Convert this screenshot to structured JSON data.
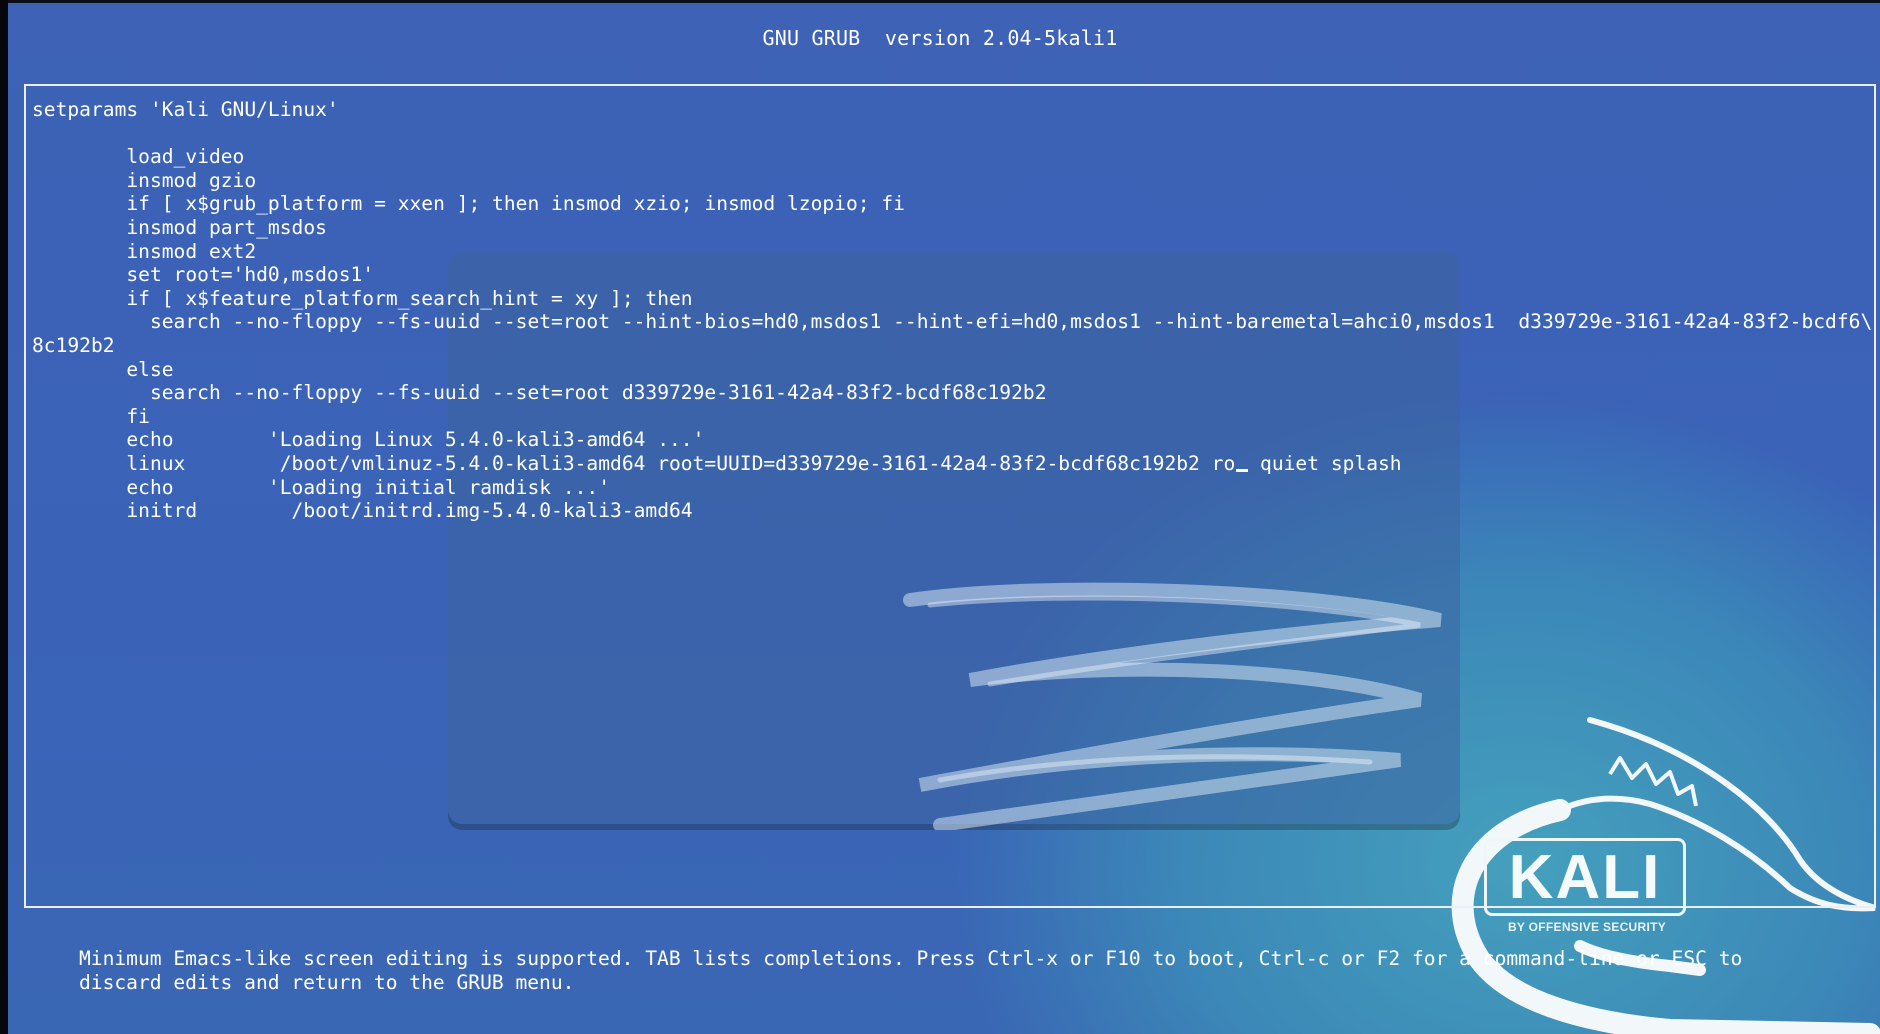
{
  "header": {
    "title": "GNU GRUB  version 2.04-5kali1"
  },
  "editor": {
    "lines": [
      "setparams 'Kali GNU/Linux'",
      "",
      "        load_video",
      "        insmod gzio",
      "        if [ x$grub_platform = xxen ]; then insmod xzio; insmod lzopio; fi",
      "        insmod part_msdos",
      "        insmod ext2",
      "        set root='hd0,msdos1'",
      "        if [ x$feature_platform_search_hint = xy ]; then",
      "          search --no-floppy --fs-uuid --set=root --hint-bios=hd0,msdos1 --hint-efi=hd0,msdos1 --hint-baremetal=ahci0,msdos1  d339729e-3161-42a4-83f2-bcdf6\\",
      "8c192b2",
      "        else",
      "          search --no-floppy --fs-uuid --set=root d339729e-3161-42a4-83f2-bcdf68c192b2",
      "        fi",
      "        echo        'Loading Linux 5.4.0-kali3-amd64 ...'",
      "        linux        /boot/vmlinuz-5.4.0-kali3-amd64 root=UUID=d339729e-3161-42a4-83f2-bcdf68c192b2 ro",
      "        echo        'Loading initial ramdisk ...'",
      "        initrd        /boot/initrd.img-5.4.0-kali3-amd64"
    ],
    "linux_line_after_cursor": " quiet splash"
  },
  "footer": {
    "help_line_1": "Minimum Emacs-like screen editing is supported. TAB lists completions. Press Ctrl-x or F10 to boot, Ctrl-c or F2 for a command-line or ESC to",
    "help_line_2": "discard edits and return to the GRUB menu."
  },
  "background": {
    "logo_text": "KALI",
    "logo_subtext": "BY OFFENSIVE SECURITY",
    "icons": [
      "kali-dragon-icon",
      "swirl-graphic"
    ]
  },
  "colors": {
    "background": "#3b63b7",
    "text": "#ffffff",
    "border": "#e9eef8",
    "accent_teal": "#46aabe"
  }
}
